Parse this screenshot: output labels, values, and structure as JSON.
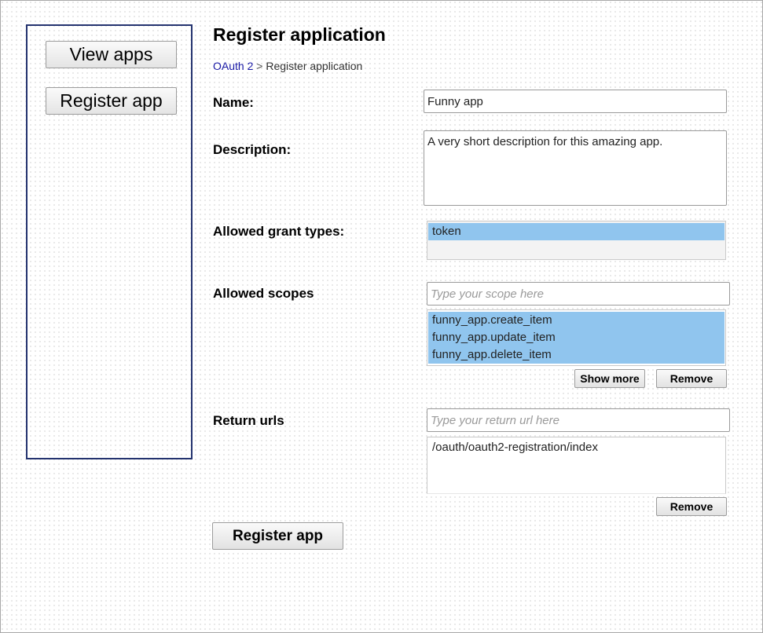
{
  "sidebar": {
    "view_apps": "View apps",
    "register_app": "Register app"
  },
  "page": {
    "title": "Register application"
  },
  "breadcrumb": {
    "root": "OAuth 2",
    "separator": ">",
    "current": "Register application"
  },
  "form": {
    "name_label": "Name:",
    "name_value": "Funny app",
    "description_label": "Description:",
    "description_value": "A very short description for this amazing app.",
    "grant_types_label": "Allowed grant types:",
    "grant_types": [
      "token"
    ],
    "scopes_label": "Allowed scopes",
    "scope_placeholder": "Type your scope here",
    "scopes": [
      "funny_app.create_item",
      "funny_app.update_item",
      "funny_app.delete_item"
    ],
    "show_more": "Show more",
    "remove_scopes": "Remove",
    "return_urls_label": "Return urls",
    "return_url_placeholder": "Type your return url here",
    "return_urls": [
      "/oauth/oauth2-registration/index"
    ],
    "remove_urls": "Remove",
    "submit": "Register app"
  },
  "colors": {
    "sidebar_border": "#24336f",
    "selected_option": "#90c5ee",
    "link": "#1a1aa6"
  }
}
